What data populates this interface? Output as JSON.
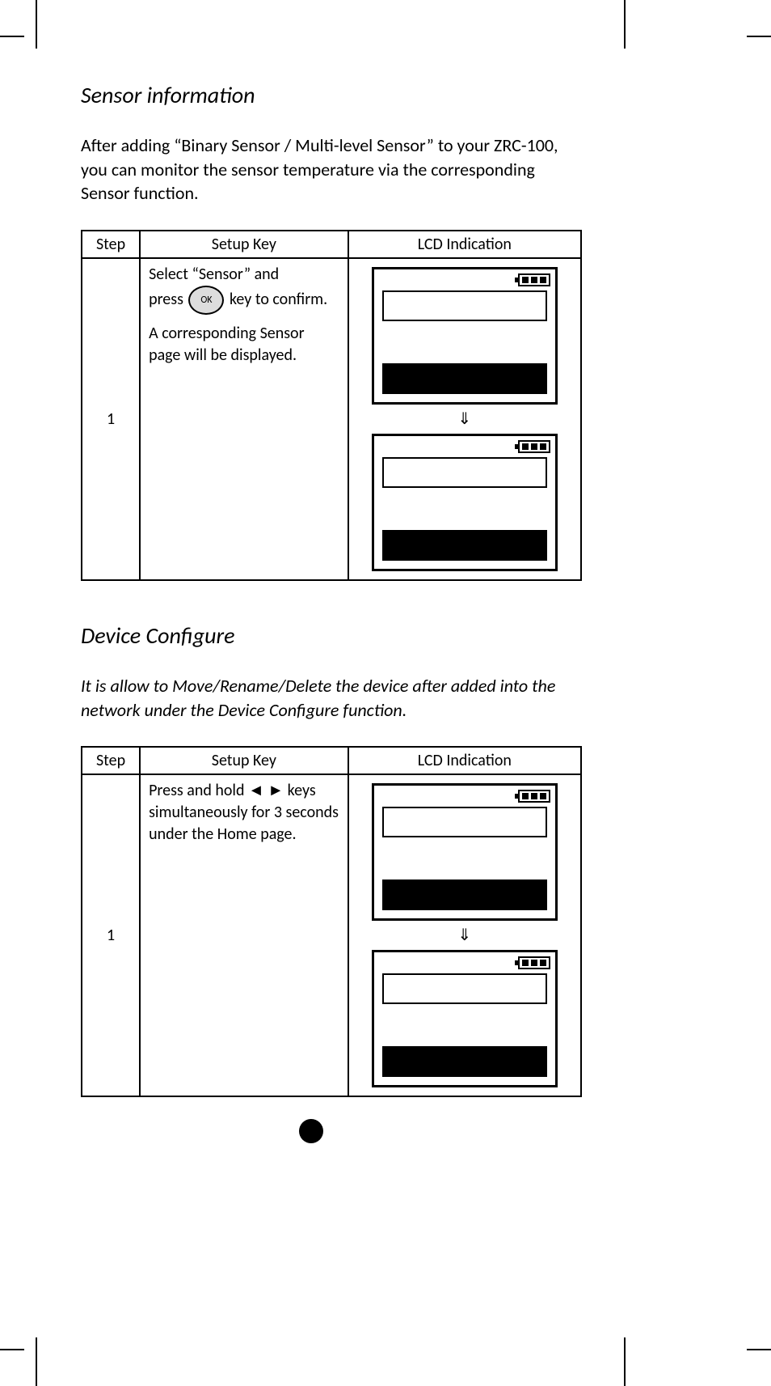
{
  "section1": {
    "title": "Sensor information",
    "intro": "After adding “Binary Sensor / Multi-level Sensor” to your ZRC-100, you can monitor the sensor temperature via the corresponding Sensor function.",
    "table": {
      "headers": {
        "step": "Step",
        "key": "Setup Key",
        "lcd": "LCD Indication"
      },
      "row": {
        "step": "1",
        "key_line1a": "Select “Sensor” and",
        "key_press": "press",
        "ok_label": "OK",
        "key_line1b": "key to confirm.",
        "key_line2": "A corresponding Sensor page will be displayed.",
        "arrow": "⇓"
      }
    }
  },
  "section2": {
    "title": "Device Configure",
    "intro": "It is allow to Move/Rename/Delete the device after added into the network under the Device Configure function.",
    "table": {
      "headers": {
        "step": "Step",
        "key": "Setup Key",
        "lcd": "LCD Indication"
      },
      "row": {
        "step": "1",
        "key_text": "Press and hold ◄ ► keys simultaneously for 3 seconds under the Home page.",
        "arrow": "⇓"
      }
    }
  }
}
